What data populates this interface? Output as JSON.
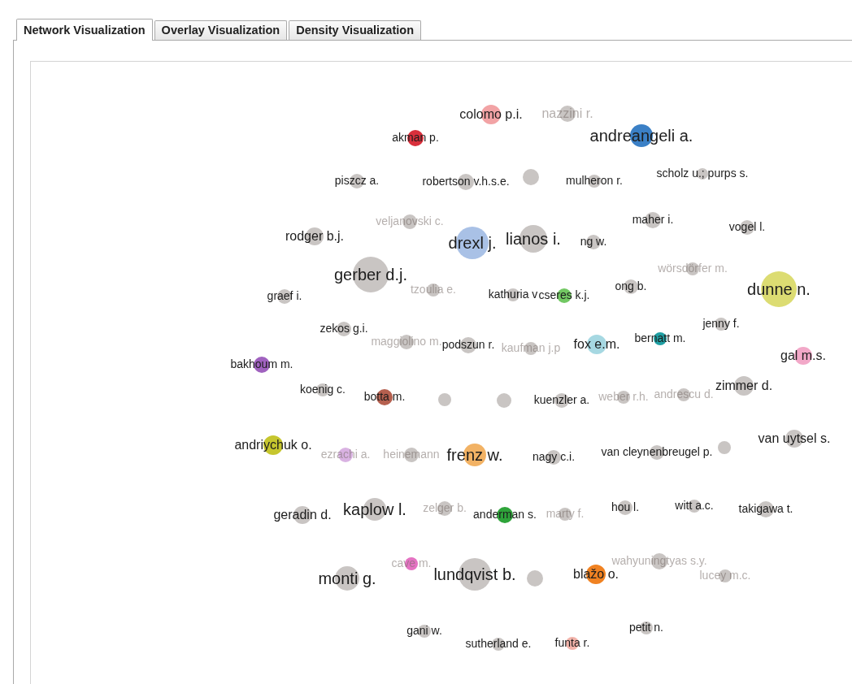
{
  "tabs": [
    {
      "label": "Network Visualization",
      "selected": true
    },
    {
      "label": "Overlay Visualization",
      "selected": false
    },
    {
      "label": "Density Visualization",
      "selected": false
    }
  ],
  "network": {
    "nodes": [
      {
        "label": "colomo p.i.",
        "kind": "medium",
        "faded": false,
        "color": "#f2a3a5"
      },
      {
        "label": "nazzini r.",
        "kind": "medium",
        "faded": true,
        "color": "#c9c5c3"
      },
      {
        "label": "akman p.",
        "kind": "small",
        "faded": false,
        "color": "#d8303c"
      },
      {
        "label": "andreangeli a.",
        "kind": "large",
        "faded": false,
        "color": "#3b80c6"
      },
      {
        "label": "piszcz a.",
        "kind": "small",
        "faded": false,
        "color": "#c9c5c3"
      },
      {
        "label": "robertson v.h.s.e.",
        "kind": "small",
        "faded": false,
        "color": "#c9c5c3"
      },
      {
        "color": "#c9c5c3"
      },
      {
        "label": "mulheron r.",
        "kind": "small",
        "faded": false,
        "color": "#c9c5c3"
      },
      {
        "label": "scholz u.; purps s.",
        "kind": "small",
        "faded": false,
        "color": "#c9c5c3"
      },
      {
        "label": "veljanovski c.",
        "kind": "small",
        "faded": true,
        "color": "#c9c5c3"
      },
      {
        "label": "maher i.",
        "kind": "small",
        "faded": false,
        "color": "#c9c5c3"
      },
      {
        "label": "rodger b.j.",
        "kind": "medium",
        "faded": false,
        "color": "#c9c5c3"
      },
      {
        "label": "drexl j.",
        "kind": "large",
        "faded": false,
        "color": "#a9c1e6"
      },
      {
        "label": "lianos i.",
        "kind": "large",
        "faded": false,
        "color": "#c9c5c3"
      },
      {
        "label": "ng w.",
        "kind": "small",
        "faded": false,
        "color": "#c9c5c3"
      },
      {
        "label": "vogel l.",
        "kind": "small",
        "faded": false,
        "color": "#c9c5c3"
      },
      {
        "label": "gerber d.j.",
        "kind": "large",
        "faded": false,
        "color": "#c9c5c3"
      },
      {
        "label": "wörsdörfer m.",
        "kind": "small",
        "faded": true,
        "color": "#c9c5c3"
      },
      {
        "label": "graef i.",
        "kind": "small",
        "faded": false,
        "color": "#c9c5c3"
      },
      {
        "label": "tzoulia e.",
        "kind": "small",
        "faded": true,
        "color": "#c9c5c3"
      },
      {
        "label": "kathuria v",
        "kind": "small",
        "faded": false,
        "color": "#c9c5c3"
      },
      {
        "label": "cseres k.j.",
        "kind": "small",
        "faded": false,
        "color": "#72c863"
      },
      {
        "label": "ong b.",
        "kind": "small",
        "faded": false,
        "color": "#c9c5c3"
      },
      {
        "label": "dunne n.",
        "kind": "large",
        "faded": false,
        "color": "#dcdc72"
      },
      {
        "label": "zekos g.i.",
        "kind": "small",
        "faded": false,
        "color": "#c9c5c3"
      },
      {
        "label": "jenny f.",
        "kind": "small",
        "faded": false,
        "color": "#c9c5c3"
      },
      {
        "label": "maggiolino m.",
        "kind": "small",
        "faded": true,
        "color": "#c9c5c3"
      },
      {
        "label": "podszun r.",
        "kind": "small",
        "faded": false,
        "color": "#c9c5c3"
      },
      {
        "label": "kaufman j.p",
        "kind": "small",
        "faded": true,
        "color": "#c9c5c3"
      },
      {
        "label": "fox e.m.",
        "kind": "medium",
        "faded": false,
        "color": "#a6d8e2"
      },
      {
        "label": "bernatt m.",
        "kind": "small",
        "faded": false,
        "color": "#1f9fa3"
      },
      {
        "label": "bakhoum m.",
        "kind": "small",
        "faded": false,
        "color": "#a062bf"
      },
      {
        "label": "gal m.s.",
        "kind": "medium",
        "faded": false,
        "color": "#f2a8c8"
      },
      {
        "label": "koenig c.",
        "kind": "small",
        "faded": false,
        "color": "#c9c5c3"
      },
      {
        "label": "botta m.",
        "kind": "small",
        "faded": false,
        "color": "#b5604f"
      },
      {
        "color": "#c9c5c3"
      },
      {
        "color": "#c9c5c3"
      },
      {
        "label": "kuenzler a.",
        "kind": "small",
        "faded": false,
        "color": "#c9c5c3"
      },
      {
        "label": "weber r.h.",
        "kind": "small",
        "faded": true,
        "color": "#c9c5c3"
      },
      {
        "label": "andrescu d.",
        "kind": "small",
        "faded": true,
        "color": "#c9c5c3"
      },
      {
        "label": "zimmer d.",
        "kind": "medium",
        "faded": false,
        "color": "#c9c5c3"
      },
      {
        "label": "andriychuk o.",
        "kind": "medium",
        "faded": false,
        "color": "#c6c62e"
      },
      {
        "label": "ezrachi a.",
        "kind": "small",
        "faded": true,
        "color": "#d9b2e2"
      },
      {
        "label": "heinemann",
        "kind": "small",
        "faded": true,
        "color": "#c9c5c3"
      },
      {
        "label": "frenz w.",
        "kind": "large",
        "faded": false,
        "color": "#f2b264"
      },
      {
        "label": "nagy c.i.",
        "kind": "small",
        "faded": false,
        "color": "#c9c5c3"
      },
      {
        "label": "van cleynenbreugel p.",
        "kind": "small",
        "faded": false,
        "color": "#c9c5c3"
      },
      {
        "color": "#c9c5c3"
      },
      {
        "label": "van uytsel s.",
        "kind": "medium",
        "faded": false,
        "color": "#c9c5c3"
      },
      {
        "label": "geradin d.",
        "kind": "medium",
        "faded": false,
        "color": "#c9c5c3"
      },
      {
        "label": "kaplow l.",
        "kind": "large",
        "faded": false,
        "color": "#c9c5c3"
      },
      {
        "label": "zelger b.",
        "kind": "small",
        "faded": true,
        "color": "#c9c5c3"
      },
      {
        "label": "anderman s.",
        "kind": "small",
        "faded": false,
        "color": "#2ea43a"
      },
      {
        "label": "marty f.",
        "kind": "small",
        "faded": true,
        "color": "#c9c5c3"
      },
      {
        "label": "hou l.",
        "kind": "small",
        "faded": false,
        "color": "#c9c5c3"
      },
      {
        "label": "witt a.c.",
        "kind": "small",
        "faded": false,
        "color": "#c9c5c3"
      },
      {
        "label": "takigawa t.",
        "kind": "small",
        "faded": false,
        "color": "#c9c5c3"
      },
      {
        "label": "monti g.",
        "kind": "large",
        "faded": false,
        "color": "#c9c5c3"
      },
      {
        "label": "cave m.",
        "kind": "small",
        "faded": true,
        "color": "#e472c2"
      },
      {
        "label": "lundqvist b.",
        "kind": "large",
        "faded": false,
        "color": "#c9c5c3"
      },
      {
        "color": "#c9c5c3"
      },
      {
        "label": "blažo o.",
        "kind": "medium",
        "faded": false,
        "color": "#f08222"
      },
      {
        "label": "wahyuningtyas s.y.",
        "kind": "small",
        "faded": true,
        "color": "#c9c5c3"
      },
      {
        "label": "lucey m.c.",
        "kind": "small",
        "faded": true,
        "color": "#c9c5c3"
      },
      {
        "label": "gani w.",
        "kind": "small",
        "faded": false,
        "color": "#c9c5c3"
      },
      {
        "label": "sutherland e.",
        "kind": "small",
        "faded": false,
        "color": "#c9c5c3"
      },
      {
        "label": "funta r.",
        "kind": "small",
        "faded": false,
        "color": "#f2b3aa"
      },
      {
        "label": "petit n.",
        "kind": "small",
        "faded": false,
        "color": "#c9c5c3"
      }
    ]
  }
}
